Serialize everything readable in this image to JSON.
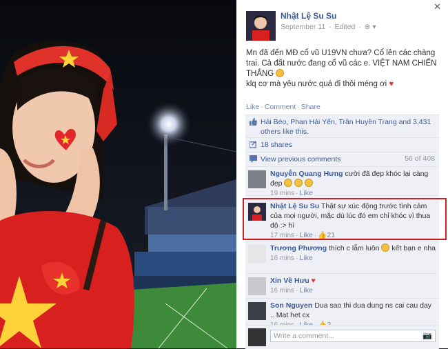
{
  "post": {
    "author": "Nhật Lệ Su Su",
    "date": "September 11",
    "edited": "Edited",
    "line1": "Mn đã đến MĐ cổ vũ U19VN chưa? Cổ lên các chàng trai. Cả đất nước đang cổ vũ các e. VIỆT NAM CHIẾN THẮNG",
    "line2": "klq cơ mà yêu nước quá đi thôi méng ơi",
    "actions": {
      "like": "Like",
      "comment": "Comment",
      "share": "Share"
    }
  },
  "likes": {
    "text": "Hải Béo, Phan Hải Yến, Trần Huyền Trang and 3,431 others like this.",
    "shares": "18 shares",
    "view_previous": "View previous comments",
    "count": "56 of 408"
  },
  "comments": [
    {
      "name": "Nguyễn Quang Hưng",
      "text": "cười đã đẹp khóc lại càng đẹp",
      "time": "19 mins",
      "like": "Like",
      "likes_count": ""
    },
    {
      "name": "Nhật Lệ Su Su",
      "text": "Thật sự xúc động trước tình cảm của mọi người, mặc dù lúc đó em chỉ khóc vì thua độ :> hì",
      "time": "17 mins",
      "like": "Like",
      "likes_count": "21"
    },
    {
      "name": "Trương Phương",
      "text": "thích c lắm luôn",
      "text2": "kết bạn e nha",
      "time": "16 mins",
      "like": "Like",
      "likes_count": ""
    },
    {
      "name": "Xin Về Hưu",
      "text": "",
      "time": "16 mins",
      "like": "Like",
      "likes_count": ""
    },
    {
      "name": "Son Nguyen",
      "text": "Dua sao thi dua dung ns cai cau day .. Mat het cx",
      "time": "16 mins",
      "like": "Like",
      "likes_count": "2"
    }
  ],
  "write": {
    "placeholder": "Write a comment..."
  },
  "icons": {
    "close": "close-icon",
    "globe": "globe-icon",
    "like": "thumbs-up-icon",
    "share": "share-icon",
    "comment": "comment-icon",
    "camera": "camera-icon"
  },
  "colors": {
    "link": "#3b5998",
    "highlight": "#d11f23",
    "panel_bg": "#eef0f5"
  }
}
